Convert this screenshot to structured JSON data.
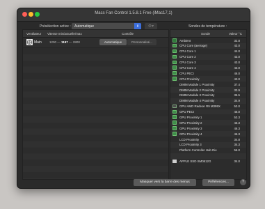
{
  "window": {
    "title": "Macs Fan Control 1.5.8.1 Free (iMac17,1)"
  },
  "toolbar": {
    "preset_label": "Présélection active :",
    "preset_value": "Automatique",
    "sensors_label": "Sondes de température :"
  },
  "fans": {
    "headers": [
      "Ventilateur",
      "Vitesse min/actuelle/max",
      "Contrôle"
    ],
    "rows": [
      {
        "name": "Main",
        "min": "1200",
        "current": "1197",
        "max": "2800",
        "auto_label": "Automatique",
        "custom_label": "Personnalisé..."
      }
    ]
  },
  "sensors": {
    "headers": [
      "Sonde",
      "Valeur °C"
    ],
    "rows": [
      {
        "name": "Ambient",
        "value": "32.8",
        "icon": "ambient-sensor-icon"
      },
      {
        "name": "CPU Core (average)",
        "value": "43.0",
        "icon": "cpu-chip-icon"
      },
      {
        "name": "CPU Core 1",
        "value": "44.0",
        "icon": "cpu-chip-icon"
      },
      {
        "name": "CPU Core 2",
        "value": "43.0",
        "icon": "cpu-chip-icon"
      },
      {
        "name": "CPU Core 3",
        "value": "43.0",
        "icon": "cpu-chip-icon"
      },
      {
        "name": "CPU Core 4",
        "value": "43.0",
        "icon": "cpu-chip-icon"
      },
      {
        "name": "CPU PECI",
        "value": "46.0",
        "icon": "cpu-chip-icon"
      },
      {
        "name": "CPU Proximity",
        "value": "43.0",
        "icon": "cpu-chip-icon"
      },
      {
        "name": "DIMM Module 1 Proximity",
        "value": "37.4",
        "icon": "memory-module-icon"
      },
      {
        "name": "DIMM Module 2 Proximity",
        "value": "33.9",
        "icon": "memory-module-icon"
      },
      {
        "name": "DIMM Module 3 Proximity",
        "value": "35.5",
        "icon": "memory-module-icon"
      },
      {
        "name": "DIMM Module 4 Proximity",
        "value": "34.9",
        "icon": "memory-module-icon"
      },
      {
        "name": "GPU AMD Radeon R9 M395X",
        "value": "53.0",
        "icon": "gpu-card-icon"
      },
      {
        "name": "GPU PECI",
        "value": "46.0",
        "icon": "gpu-chip-icon"
      },
      {
        "name": "GPU Proximity 1",
        "value": "53.3",
        "icon": "gpu-chip-icon"
      },
      {
        "name": "GPU Proximity 2",
        "value": "46.3",
        "icon": "gpu-chip-icon"
      },
      {
        "name": "GPU Proximity 3",
        "value": "46.3",
        "icon": "gpu-chip-icon"
      },
      {
        "name": "GPU Proximity 4",
        "value": "46.3",
        "icon": "gpu-chip-icon"
      },
      {
        "name": "LCD Proximity",
        "value": "34.8",
        "icon": "memory-module-icon"
      },
      {
        "name": "LCD Proximity 3",
        "value": "34.3",
        "icon": "memory-module-icon"
      },
      {
        "name": "Platform Controller Hub Die",
        "value": "56.0",
        "icon": "memory-module-icon"
      },
      {
        "name": "",
        "value": "",
        "icon": ""
      },
      {
        "name": "APPLE SSD SM0512G",
        "value": "34.0",
        "icon": "hard-drive-icon"
      }
    ]
  },
  "footer": {
    "menubar_label": "Masquer vers la barre des menus",
    "prefs_label": "Préférences...",
    "help_label": "?"
  }
}
